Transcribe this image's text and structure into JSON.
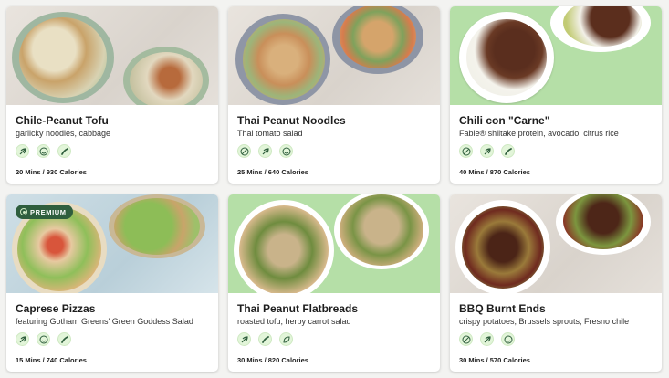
{
  "cards": [
    {
      "title": "Chile-Peanut Tofu",
      "subtitle": "garlicky noodles, cabbage",
      "meta": "20 Mins / 930 Calories",
      "icons": [
        "leaf-sprout-icon",
        "smile-icon",
        "pepper-icon"
      ],
      "badge": ""
    },
    {
      "title": "Thai Peanut Noodles",
      "subtitle": "Thai tomato salad",
      "meta": "25 Mins / 640 Calories",
      "icons": [
        "gluten-free-icon",
        "leaf-sprout-icon",
        "smile-icon"
      ],
      "badge": ""
    },
    {
      "title": "Chili con \"Carne\"",
      "subtitle": "Fable® shiitake protein, avocado, citrus rice",
      "meta": "40 Mins / 870 Calories",
      "icons": [
        "gluten-free-icon",
        "leaf-sprout-icon",
        "pepper-icon"
      ],
      "badge": ""
    },
    {
      "title": "Caprese Pizzas",
      "subtitle": "featuring Gotham Greens' Green Goddess Salad",
      "meta": "15 Mins / 740 Calories",
      "icons": [
        "leaf-sprout-icon",
        "smile-icon",
        "pepper-icon"
      ],
      "badge": "PREMIUM"
    },
    {
      "title": "Thai Peanut Flatbreads",
      "subtitle": "roasted tofu, herby carrot salad",
      "meta": "30 Mins / 820 Calories",
      "icons": [
        "leaf-sprout-icon",
        "pepper-icon",
        "leaf-icon"
      ],
      "badge": ""
    },
    {
      "title": "BBQ Burnt Ends",
      "subtitle": "crispy potatoes, Brussels sprouts, Fresno chile",
      "meta": "30 Mins / 570 Calories",
      "icons": [
        "gluten-free-icon",
        "leaf-sprout-icon",
        "smile-icon"
      ],
      "badge": ""
    }
  ],
  "colors": {
    "badge_bg": "#2f5e3d",
    "icon_bg": "#e2f5d9",
    "icon_fg": "#2f5e3d",
    "green_bg": "#b5dfa7"
  }
}
